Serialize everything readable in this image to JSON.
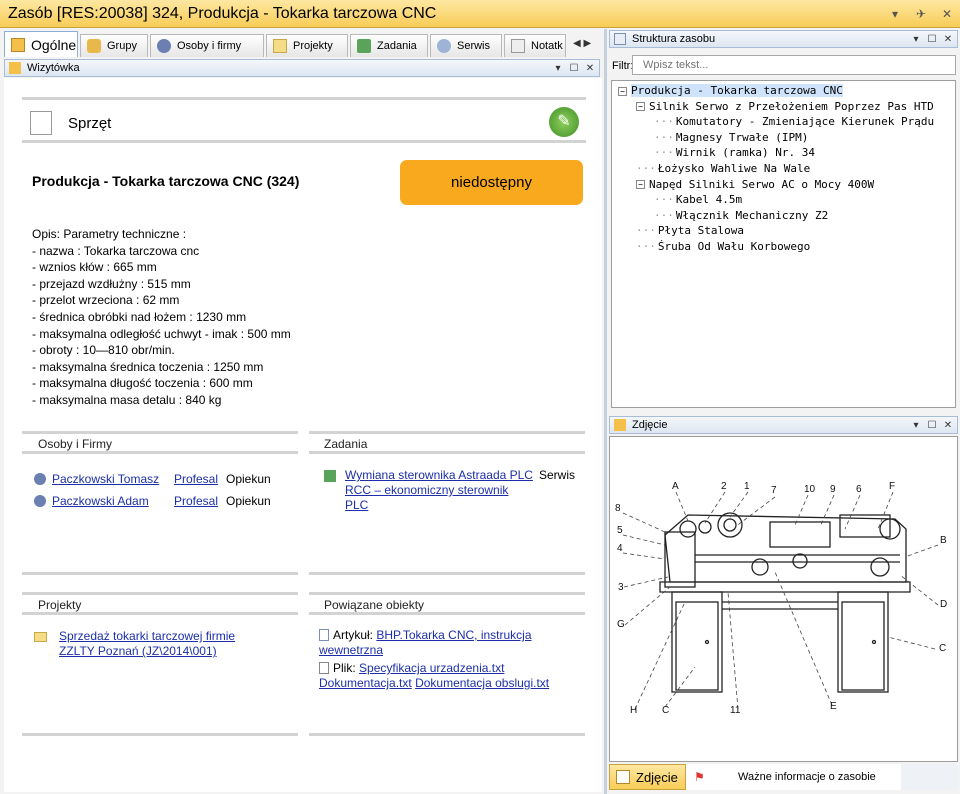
{
  "title": "Zasób [RES:20038] 324, Produkcja - Tokarka tarczowa CNC",
  "window_controls": [
    "▾",
    "✈",
    "✕"
  ],
  "tabs": [
    {
      "label": "Ogólne",
      "icon": "card-icon"
    },
    {
      "label": "Grupy",
      "icon": "groups-icon"
    },
    {
      "label": "Osoby i firmy",
      "icon": "people-icon"
    },
    {
      "label": "Projekty",
      "icon": "folder-icon"
    },
    {
      "label": "Zadania",
      "icon": "task-icon"
    },
    {
      "label": "Serwis",
      "icon": "service-icon"
    },
    {
      "label": "Notatk",
      "icon": "note-icon"
    }
  ],
  "left_panel": {
    "title": "Wizytówka",
    "header": "Sprzęt",
    "resource_name": "Produkcja - Tokarka tarczowa CNC (324)",
    "status": "niedostępny",
    "status_color": "#f8a91d",
    "description": [
      "Opis: Parametry techniczne :",
      "- nazwa : Tokarka tarczowa cnc",
      "- wznios kłów : 665 mm",
      "- przejazd wzdłużny : 515 mm",
      "- przelot wrzeciona : 62 mm",
      "- średnica obróbki nad łożem : 1230 mm",
      "- maksymalna odległość uchwyt - imak : 500 mm",
      "- obroty : 10—810 obr/min.",
      "- maksymalna średnica toczenia : 1250 mm",
      "- maksymalna długość toczenia : 600 mm",
      "- maksymalna masa detalu : 840 kg"
    ]
  },
  "people": {
    "title": "Osoby i Firmy",
    "rows": [
      {
        "name": "Paczkowski Tomasz",
        "company": "Profesal",
        "role": "Opiekun"
      },
      {
        "name": "Paczkowski Adam",
        "company": "Profesal",
        "role": "Opiekun"
      }
    ]
  },
  "tasks": {
    "title": "Zadania",
    "rows": [
      {
        "name": "Wymiana sterownika Astraada PLC RCC – ekonomiczny sterownik PLC",
        "type": "Serwis"
      }
    ]
  },
  "projects": {
    "title": "Projekty",
    "rows": [
      {
        "name": "Sprzedaż tokarki tarczowej firmie ZZLTY Poznań (JZ\\2014\\001)"
      }
    ]
  },
  "related": {
    "title": "Powiązane obiekty",
    "article_label": "Artykuł:",
    "article": "BHP.Tokarka CNC, instrukcja wewnetrzna",
    "file_label": "Plik:",
    "files": [
      "Specyfikacja urzadzenia.txt",
      "Dokumentacja.txt",
      "Dokumentacja obslugi.txt"
    ]
  },
  "structure": {
    "title": "Struktura zasobu",
    "filter_label": "Filtr:",
    "filter_placeholder": "Wpisz tekst...",
    "tree": [
      {
        "label": "Produkcja - Tokarka tarczowa CNC",
        "level": 0,
        "exp": "⊟"
      },
      {
        "label": "Silnik Serwo z Przełożeniem Poprzez Pas HTD",
        "level": 1,
        "exp": "⊟"
      },
      {
        "label": "Komutatory - Zmieniające Kierunek Prądu",
        "level": 2,
        "exp": ""
      },
      {
        "label": "Magnesy Trwałe (IPM)",
        "level": 2,
        "exp": ""
      },
      {
        "label": "Wirnik (ramka) Nr. 34",
        "level": 2,
        "exp": ""
      },
      {
        "label": "Łożysko Wahliwe Na Wale",
        "level": 1,
        "exp": ""
      },
      {
        "label": "Napęd Silniki Serwo AC o Mocy 400W",
        "level": 1,
        "exp": "⊟"
      },
      {
        "label": "Kabel 4.5m",
        "level": 2,
        "exp": ""
      },
      {
        "label": "Włącznik Mechaniczny Z2",
        "level": 2,
        "exp": ""
      },
      {
        "label": "Płyta Stalowa",
        "level": 1,
        "exp": ""
      },
      {
        "label": "Śruba Od Wału Korbowego",
        "level": 1,
        "exp": ""
      }
    ]
  },
  "photo": {
    "title": "Zdjęcie",
    "labels": [
      "A",
      "2",
      "1",
      "7",
      "10",
      "9",
      "6",
      "F",
      "8",
      "5",
      "4",
      "B",
      "3",
      "D",
      "G",
      "C",
      "H",
      "C",
      "11",
      "E"
    ]
  },
  "bottom_tabs": [
    {
      "label": "Zdjęcie"
    },
    {
      "label": "Ważne informacje o zasobie"
    }
  ]
}
